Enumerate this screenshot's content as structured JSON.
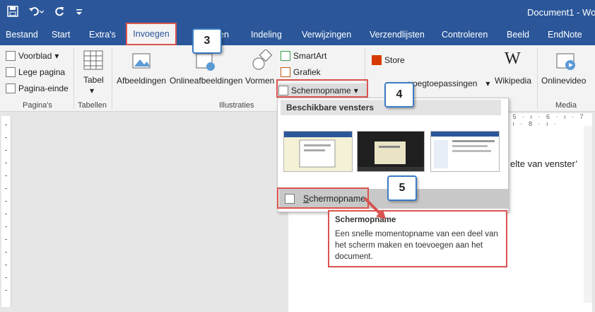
{
  "qat": {
    "save_icon": "save-icon",
    "undo_icon": "undo-icon",
    "redo_icon": "redo-icon",
    "customize_icon": "customize-icon"
  },
  "title": "Document1 - Wo",
  "tabs": [
    "Bestand",
    "Start",
    "Extra's",
    "Invoegen",
    "en",
    "Indeling",
    "Verwijzingen",
    "Verzendlijsten",
    "Controleren",
    "Beeld",
    "EndNote"
  ],
  "active_tab": "Invoegen",
  "ribbon": {
    "pages": {
      "items": [
        "Voorblad",
        "Lege pagina",
        "Pagina-einde"
      ],
      "label": "Pagina's"
    },
    "tables": {
      "item": "Tabel",
      "label": "Tabellen"
    },
    "illustrations": {
      "items": [
        "Afbeeldingen",
        "Onlineafbeeldingen",
        "Vormen",
        "SmartArt",
        "Grafiek",
        "Schermopname"
      ],
      "label": "Illustraties"
    },
    "addins": {
      "store": "Store",
      "myaddins": "voegtoepassingen",
      "wikipedia": "Wikipedia"
    },
    "media": {
      "item": "Onlinevideo",
      "label": "Media"
    }
  },
  "dropdown": {
    "header": "Beschikbare vensters",
    "item_underline": "S",
    "item_rest": "chermopname"
  },
  "tooltip": {
    "title": "Schermopname",
    "body": "Een snelle momentopname van een deel van het scherm maken en toevoegen aan het document."
  },
  "callouts": [
    "3",
    "4",
    "5"
  ],
  "doc_text": "elte van venster’",
  "ruler_text": "· 5 · ı · 6 · ı · 7 · ı · 8 · ı ·",
  "colors": {
    "accent": "#2b579a",
    "highlight": "#d9534f",
    "callout_border": "#3b7cc4"
  }
}
